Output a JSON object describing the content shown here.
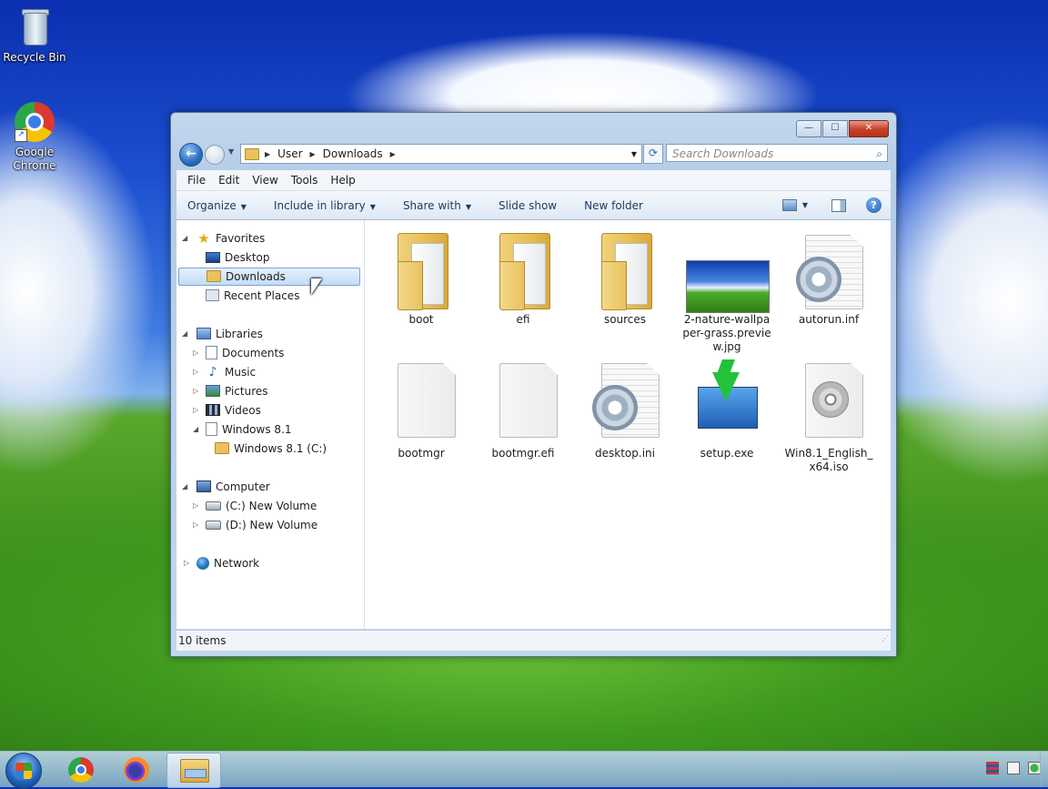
{
  "desktop": {
    "icons": [
      {
        "label": "Recycle Bin",
        "icon": "recycle-bin-icon"
      },
      {
        "label": "Google Chrome",
        "icon": "chrome-icon"
      }
    ]
  },
  "window": {
    "caption": {
      "minimize": "—",
      "maximize": "☐",
      "close": "✕"
    },
    "nav": {
      "back": "←",
      "forward": "→",
      "dropdown": "▼"
    },
    "address": {
      "crumbs": [
        "User",
        "Downloads"
      ],
      "separator": "▶",
      "dropdown": "▼"
    },
    "search": {
      "placeholder": "Search Downloads",
      "icon": "⌕"
    },
    "menu": [
      "File",
      "Edit",
      "View",
      "Tools",
      "Help"
    ],
    "toolbar": {
      "organize": "Organize",
      "include": "Include in library",
      "share": "Share with",
      "slideshow": "Slide show",
      "newfolder": "New folder",
      "arrow": "▼",
      "help": "?"
    },
    "tree": {
      "favorites": "Favorites",
      "desktop": "Desktop",
      "downloads": "Downloads",
      "recent": "Recent Places",
      "libraries": "Libraries",
      "documents": "Documents",
      "music": "Music",
      "pictures": "Pictures",
      "videos": "Videos",
      "win81": "Windows 8.1",
      "win81c": "Windows 8.1 (C:)",
      "computer": "Computer",
      "cdrive": "(C:) New Volume",
      "ddrive": "(D:) New Volume",
      "network": "Network",
      "expanded": "◢",
      "collapsed": "▷"
    },
    "files": [
      {
        "name": "boot",
        "type": "folder"
      },
      {
        "name": "efi",
        "type": "folder"
      },
      {
        "name": "sources",
        "type": "folder"
      },
      {
        "name": "2-nature-wallpaper-grass.preview.jpg",
        "type": "image"
      },
      {
        "name": "autorun.inf",
        "type": "settings"
      },
      {
        "name": "bootmgr",
        "type": "file"
      },
      {
        "name": "bootmgr.efi",
        "type": "file"
      },
      {
        "name": "desktop.ini",
        "type": "settings"
      },
      {
        "name": "setup.exe",
        "type": "setup"
      },
      {
        "name": "Win8.1_English_x64.iso",
        "type": "disc"
      }
    ],
    "status": "10 items"
  },
  "taskbar": {
    "apps": [
      "chrome-icon",
      "firefox-icon",
      "file-explorer-icon"
    ],
    "active": "file-explorer-icon"
  }
}
